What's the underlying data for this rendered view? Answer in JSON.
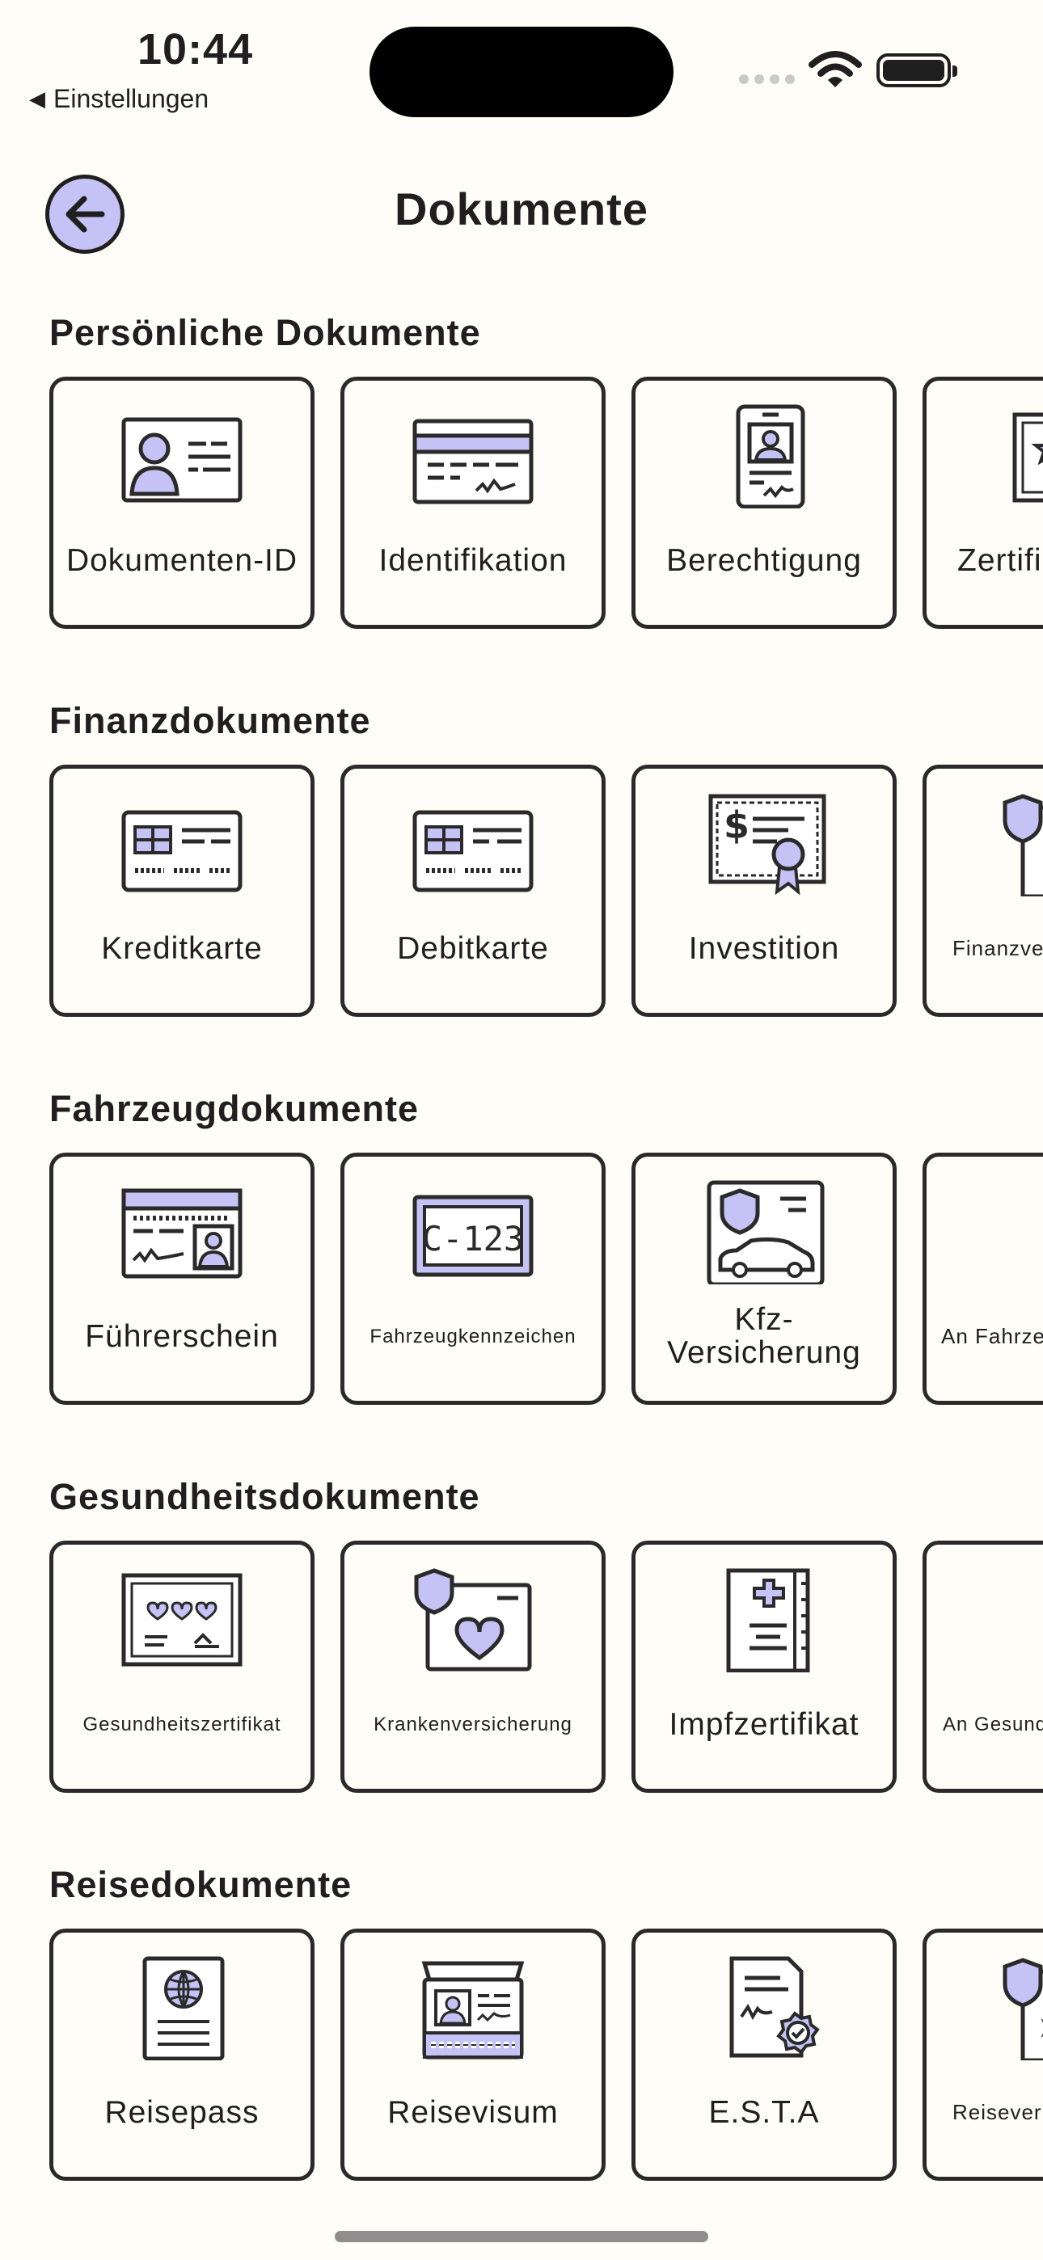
{
  "status": {
    "time": "10:44",
    "back_app": "Einstellungen"
  },
  "header": {
    "title": "Dokumente"
  },
  "sections": [
    {
      "title": "Persönliche Dokumente",
      "cards": [
        {
          "label": "Dokumenten-ID",
          "icon": "id-card-icon"
        },
        {
          "label": "Identifikation",
          "icon": "signed-card-icon"
        },
        {
          "label": "Berechtigung",
          "icon": "badge-icon"
        },
        {
          "label": "Zertifi",
          "icon": "certificate-icon"
        }
      ]
    },
    {
      "title": "Finanzdokumente",
      "cards": [
        {
          "label": "Kreditkarte",
          "icon": "credit-card-icon"
        },
        {
          "label": "Debitkarte",
          "icon": "debit-card-icon"
        },
        {
          "label": "Investition",
          "icon": "investment-certificate-icon"
        },
        {
          "label": "Finanzve",
          "icon": "shield-document-icon"
        }
      ]
    },
    {
      "title": "Fahrzeugdokumente",
      "cards": [
        {
          "label": "Führerschein",
          "icon": "drivers-license-icon"
        },
        {
          "label": "Fahrzeugkennzeichen",
          "icon": "license-plate-icon"
        },
        {
          "label": "Kfz-Versicherung",
          "icon": "car-insurance-icon"
        },
        {
          "label": "An Fahrzeug",
          "icon": "globe-document-icon"
        }
      ]
    },
    {
      "title": "Gesundheitsdokumente",
      "cards": [
        {
          "label": "Gesundheitszertifikat",
          "icon": "health-certificate-icon"
        },
        {
          "label": "Krankenversicherung",
          "icon": "health-insurance-icon"
        },
        {
          "label": "Impfzertifikat",
          "icon": "vaccination-book-icon"
        },
        {
          "label": "An Gesundhe",
          "icon": "health-document-icon"
        }
      ]
    },
    {
      "title": "Reisedokumente",
      "cards": [
        {
          "label": "Reisepass",
          "icon": "passport-icon"
        },
        {
          "label": "Reisevisum",
          "icon": "visa-icon"
        },
        {
          "label": "E.S.T.A",
          "icon": "esta-document-icon"
        },
        {
          "label": "Reisever",
          "icon": "travel-insurance-icon"
        }
      ]
    }
  ],
  "colors": {
    "accent": "#c5c3f5",
    "stroke": "#2a2a2a",
    "background": "#fffdf7"
  }
}
